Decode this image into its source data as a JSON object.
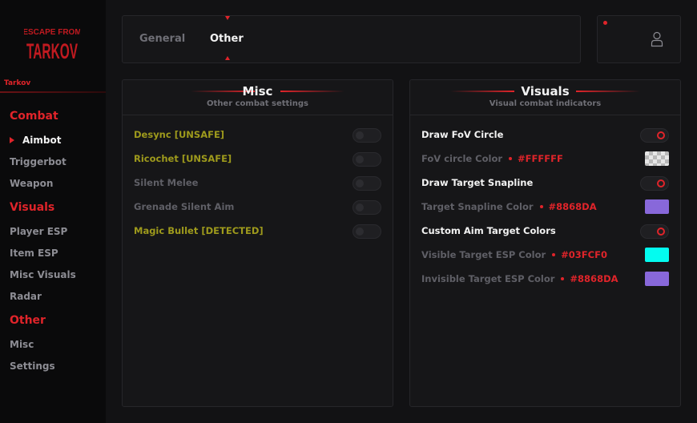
{
  "brand": {
    "logo_text_top": "ESCAPE FROM",
    "logo_text_bottom": "TARKOV",
    "name": "Tarkov"
  },
  "colors": {
    "accent": "#E0242A",
    "background": "#121214",
    "sidebar": "#0A0A0B",
    "panel": "#161618",
    "warning_text": "#9E9A1C"
  },
  "sidebar": {
    "sections": [
      {
        "title": "Combat",
        "items": [
          "Aimbot",
          "Triggerbot",
          "Weapon"
        ]
      },
      {
        "title": "Visuals",
        "items": [
          "Player ESP",
          "Item ESP",
          "Misc Visuals",
          "Radar"
        ]
      },
      {
        "title": "Other",
        "items": [
          "Misc",
          "Settings"
        ]
      }
    ],
    "active_item": "Aimbot"
  },
  "tabs": {
    "items": [
      "General",
      "Other"
    ],
    "active": "Other"
  },
  "misc": {
    "title": "Misc",
    "subtitle": "Other combat settings",
    "options": [
      {
        "label": "Desync [UNSAFE]",
        "enabled": false
      },
      {
        "label": "Ricochet [UNSAFE]",
        "enabled": false
      },
      {
        "label": "Silent Melee",
        "enabled": false
      },
      {
        "label": "Grenade Silent Aim",
        "enabled": false
      },
      {
        "label": "Magic Bullet [DETECTED]",
        "enabled": false
      }
    ]
  },
  "visuals": {
    "title": "Visuals",
    "subtitle": "Visual combat indicators",
    "draw_fov": {
      "label": "Draw FoV Circle",
      "enabled": true
    },
    "fov_color": {
      "label": "FoV circle Color",
      "hex": "#FFFFFF"
    },
    "draw_snapline": {
      "label": "Draw Target Snapline",
      "enabled": true
    },
    "snapline_color": {
      "label": "Target Snapline Color",
      "hex": "#8868DA"
    },
    "custom_colors": {
      "label": "Custom Aim Target Colors",
      "enabled": true
    },
    "visible_color": {
      "label": "Visible Target ESP Color",
      "hex": "#03FCF0"
    },
    "invisible_color": {
      "label": "Invisible Target ESP Color",
      "hex": "#8868DA"
    }
  },
  "icons": {
    "profile": "user-icon",
    "notification": "notification-dot",
    "active_marker": "triangle-right-icon"
  }
}
